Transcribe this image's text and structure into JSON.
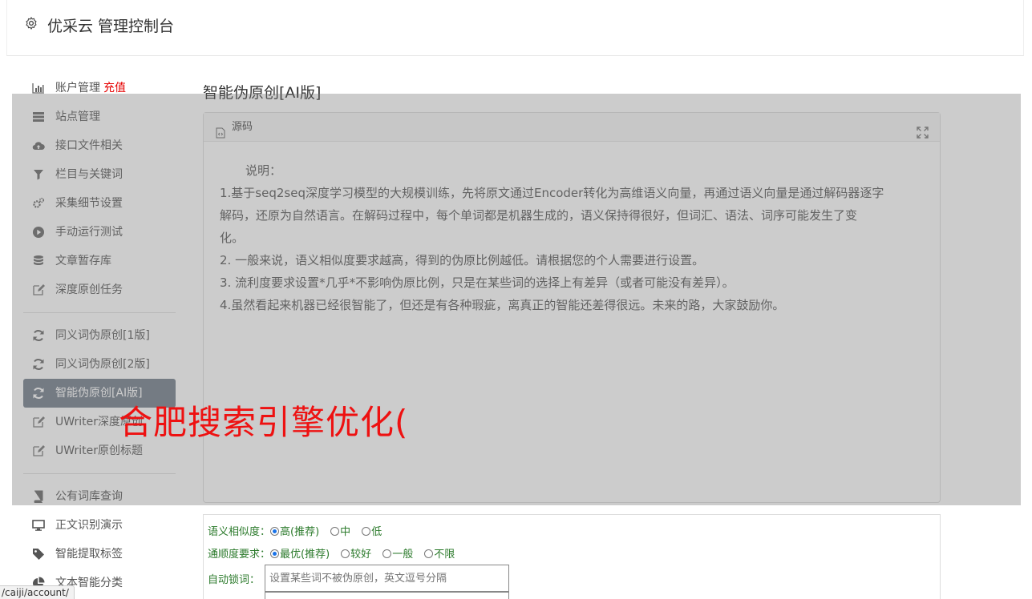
{
  "header": {
    "title": "优采云 管理控制台",
    "icon": "gear-icon"
  },
  "sidebar": {
    "group1": [
      {
        "label": "账户管理",
        "extra": "充值",
        "icon": "bar-chart-icon"
      },
      {
        "label": "站点管理",
        "icon": "server-icon"
      },
      {
        "label": "接口文件相关",
        "icon": "cloud-upload-icon"
      },
      {
        "label": "栏目与关键词",
        "icon": "filter-icon"
      },
      {
        "label": "采集细节设置",
        "icon": "gears-icon"
      },
      {
        "label": "手动运行测试",
        "icon": "play-circle-icon"
      },
      {
        "label": "文章暂存库",
        "icon": "database-icon"
      },
      {
        "label": "深度原创任务",
        "icon": "edit-icon"
      }
    ],
    "group2": [
      {
        "label": "同义词伪原创[1版]",
        "icon": "refresh-icon"
      },
      {
        "label": "同义词伪原创[2版]",
        "icon": "refresh-icon"
      },
      {
        "label": "智能伪原创[AI版]",
        "icon": "refresh-icon",
        "active": true
      },
      {
        "label": "UWriter深度原创",
        "icon": "edit-icon"
      },
      {
        "label": "UWriter原创标题",
        "icon": "edit-icon"
      }
    ],
    "group3": [
      {
        "label": "公有词库查询",
        "icon": "book-icon"
      },
      {
        "label": "正文识别演示",
        "icon": "monitor-icon"
      },
      {
        "label": "智能提取标签",
        "icon": "tag-icon"
      },
      {
        "label": "文本智能分类",
        "icon": "pie-chart-icon"
      }
    ]
  },
  "main": {
    "title": "智能伪原创[AI版]",
    "panel": {
      "head_label": "源码",
      "lines": [
        "说明：",
        "1.基于seq2seq深度学习模型的大规模训练，先将原文通过Encoder转化为高维语义向量，再通过语义向量是通过解码器逐字",
        "解码，还原为自然语言。在解码过程中，每个单词都是机器生成的，语义保持得很好，但词汇、语法、词序可能发生了变",
        "化。",
        "2. 一般来说，语义相似度要求越高，得到的伪原比例越低。请根据您的个人需要进行设置。",
        "3. 流利度要求设置*几乎*不影响伪原比例，只是在某些词的选择上有差异（或者可能没有差异）。",
        "4.虽然看起来机器已经很智能了，但还是有各种瑕疵，离真正的智能还差得很远。未来的路，大家鼓励你。"
      ]
    },
    "options": {
      "similarity_label": "语义相似度：",
      "similarity": [
        "高(推荐)",
        "中",
        "低"
      ],
      "fluency_label": "通顺度要求：",
      "fluency": [
        "最优(推荐)",
        "较好",
        "一般",
        "不限"
      ],
      "lock_label": "自动锁词：",
      "lock_placeholder": "设置某些词不被伪原创，英文逗号分隔"
    }
  },
  "watermark": "合肥搜索引擎优化(",
  "statusbar": "/caiji/account/"
}
